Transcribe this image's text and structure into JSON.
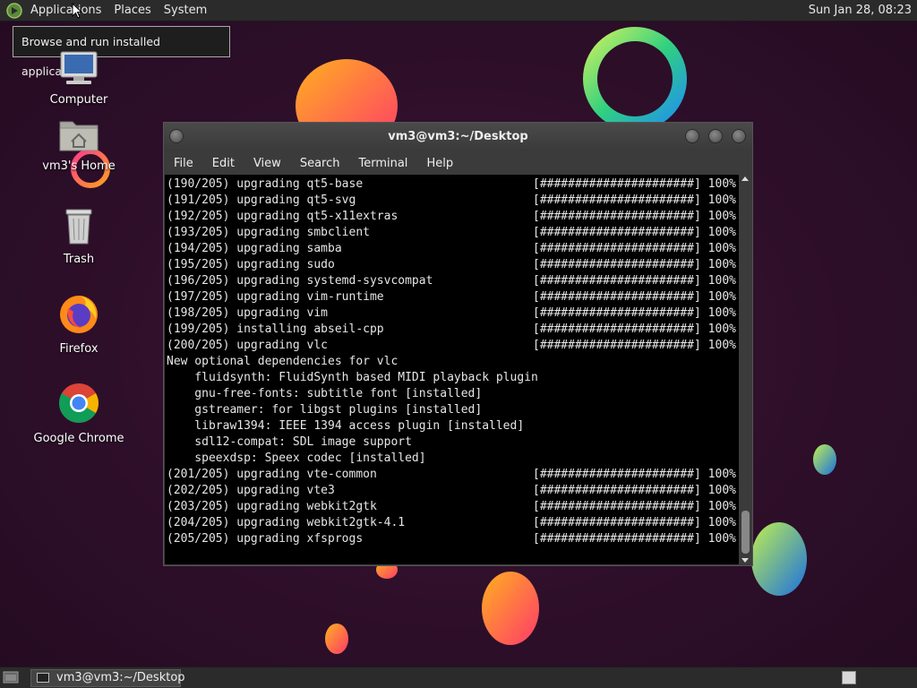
{
  "top_panel": {
    "menus": [
      "Applications",
      "Places",
      "System"
    ],
    "clock": "Sun Jan 28, 08:23"
  },
  "tooltip": "Browse and run installed applications",
  "desktop_icons": [
    {
      "label": "Computer",
      "icon": "computer-icon"
    },
    {
      "label": "vm3's Home",
      "icon": "home-folder-icon"
    },
    {
      "label": "Trash",
      "icon": "trash-icon"
    },
    {
      "label": "Firefox",
      "icon": "firefox-icon"
    },
    {
      "label": "Google Chrome",
      "icon": "chrome-icon"
    }
  ],
  "terminal": {
    "title": "vm3@vm3:~/Desktop",
    "menu": [
      "File",
      "Edit",
      "View",
      "Search",
      "Terminal",
      "Help"
    ],
    "progress_bar": "[######################] 100%",
    "lines": [
      {
        "text": "(190/205) upgrading qt5-base",
        "bar": true
      },
      {
        "text": "(191/205) upgrading qt5-svg",
        "bar": true
      },
      {
        "text": "(192/205) upgrading qt5-x11extras",
        "bar": true
      },
      {
        "text": "(193/205) upgrading smbclient",
        "bar": true
      },
      {
        "text": "(194/205) upgrading samba",
        "bar": true
      },
      {
        "text": "(195/205) upgrading sudo",
        "bar": true
      },
      {
        "text": "(196/205) upgrading systemd-sysvcompat",
        "bar": true
      },
      {
        "text": "(197/205) upgrading vim-runtime",
        "bar": true
      },
      {
        "text": "(198/205) upgrading vim",
        "bar": true
      },
      {
        "text": "(199/205) installing abseil-cpp",
        "bar": true
      },
      {
        "text": "(200/205) upgrading vlc",
        "bar": true
      },
      {
        "text": "New optional dependencies for vlc",
        "bar": false
      },
      {
        "text": "    fluidsynth: FluidSynth based MIDI playback plugin",
        "bar": false
      },
      {
        "text": "    gnu-free-fonts: subtitle font [installed]",
        "bar": false
      },
      {
        "text": "    gstreamer: for libgst plugins [installed]",
        "bar": false
      },
      {
        "text": "    libraw1394: IEEE 1394 access plugin [installed]",
        "bar": false
      },
      {
        "text": "    sdl12-compat: SDL image support",
        "bar": false
      },
      {
        "text": "    speexdsp: Speex codec [installed]",
        "bar": false
      },
      {
        "text": "(201/205) upgrading vte-common",
        "bar": true
      },
      {
        "text": "(202/205) upgrading vte3",
        "bar": true
      },
      {
        "text": "(203/205) upgrading webkit2gtk",
        "bar": true
      },
      {
        "text": "(204/205) upgrading webkit2gtk-4.1",
        "bar": true
      },
      {
        "text": "(205/205) upgrading xfsprogs",
        "bar": true
      }
    ]
  },
  "taskbar": {
    "task_label": "vm3@vm3:~/Desktop"
  }
}
